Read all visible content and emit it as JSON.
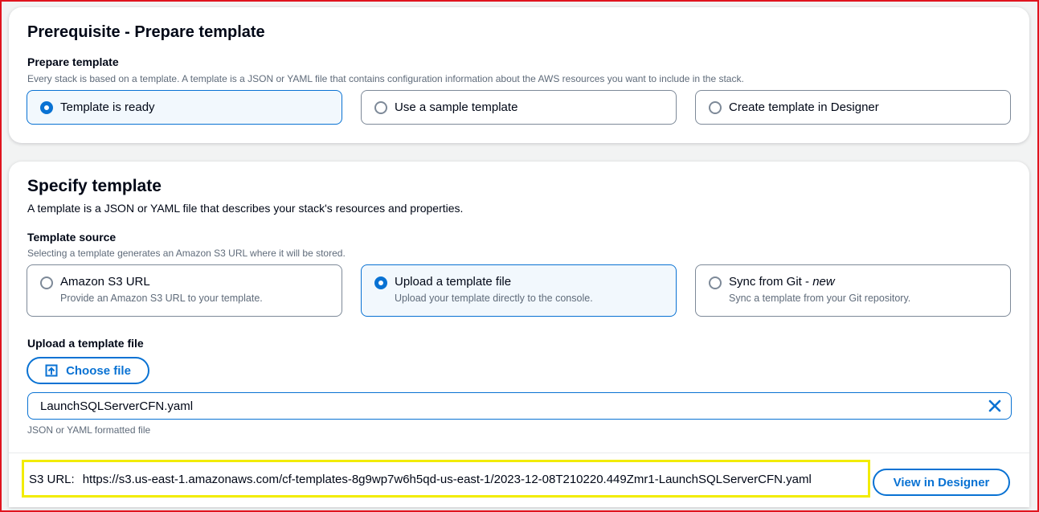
{
  "prereq": {
    "title": "Prerequisite - Prepare template",
    "label": "Prepare template",
    "description": "Every stack is based on a template. A template is a JSON or YAML file that contains configuration information about the AWS resources you want to include in the stack.",
    "options": [
      {
        "label": "Template is ready",
        "selected": true
      },
      {
        "label": "Use a sample template",
        "selected": false
      },
      {
        "label": "Create template in Designer",
        "selected": false
      }
    ]
  },
  "specify": {
    "title": "Specify template",
    "description": "A template is a JSON or YAML file that describes your stack's resources and properties.",
    "source_label": "Template source",
    "source_description": "Selecting a template generates an Amazon S3 URL where it will be stored.",
    "sources": [
      {
        "label": "Amazon S3 URL",
        "description": "Provide an Amazon S3 URL to your template.",
        "selected": false
      },
      {
        "label": "Upload a template file",
        "description": "Upload your template directly to the console.",
        "selected": true
      },
      {
        "label": "Sync from Git - ",
        "tag": "new",
        "description": "Sync a template from your Git repository.",
        "selected": false
      }
    ],
    "upload_label": "Upload a template file",
    "choose_file_label": "Choose file",
    "file_name": "LaunchSQLServerCFN.yaml",
    "file_hint": "JSON or YAML formatted file"
  },
  "s3": {
    "label": "S3 URL:",
    "url": "https://s3.us-east-1.amazonaws.com/cf-templates-8g9wp7w6h5qd-us-east-1/2023-12-08T210220.449Zmr1-LaunchSQLServerCFN.yaml",
    "view_button": "View in Designer"
  },
  "colors": {
    "accent": "#0972d3",
    "highlight_box": "#f2ec00",
    "outer_border": "#e0141e"
  }
}
